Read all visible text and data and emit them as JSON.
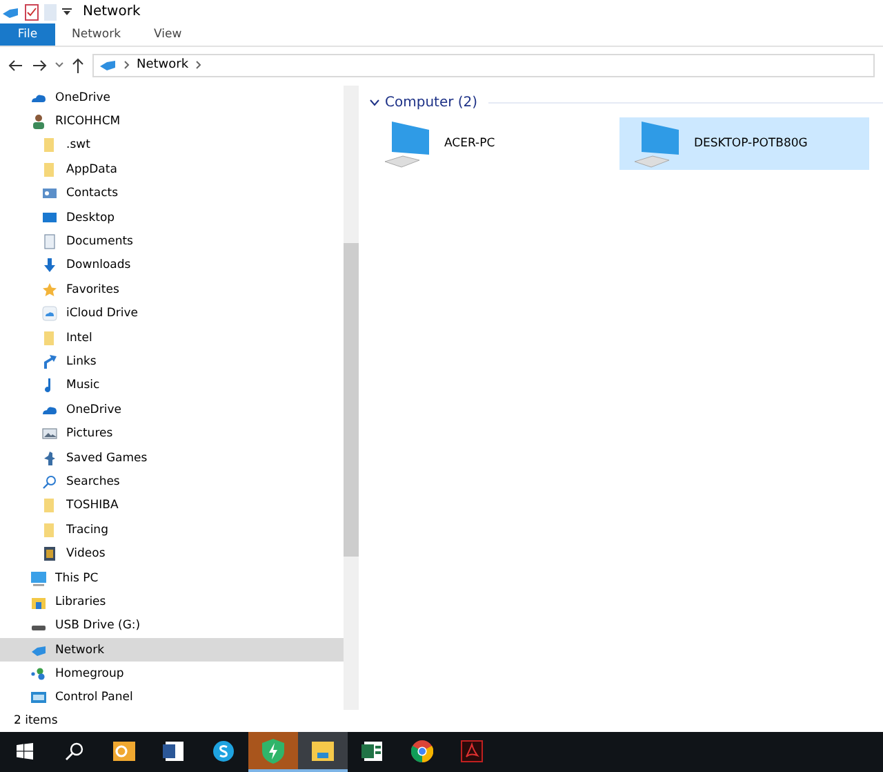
{
  "window": {
    "title": "Network"
  },
  "ribbon_tabs": [
    {
      "label": "File",
      "selected": true
    },
    {
      "label": "Network",
      "selected": false
    },
    {
      "label": "View",
      "selected": false
    }
  ],
  "address": {
    "crumbs": [
      "Network"
    ]
  },
  "nav": [
    {
      "label": "OneDrive",
      "kind": "cloud",
      "selected": false
    },
    {
      "label": "RICOHHCM",
      "kind": "user",
      "selected": false,
      "children": [
        {
          "label": ".swt",
          "kind": "folder",
          "selected": false
        },
        {
          "label": "AppData",
          "kind": "folder",
          "selected": false
        },
        {
          "label": "Contacts",
          "kind": "contacts",
          "selected": false
        },
        {
          "label": "Desktop",
          "kind": "desktop",
          "selected": false
        },
        {
          "label": "Documents",
          "kind": "document",
          "selected": false
        },
        {
          "label": "Downloads",
          "kind": "download",
          "selected": false
        },
        {
          "label": "Favorites",
          "kind": "star",
          "selected": false
        },
        {
          "label": "iCloud Drive",
          "kind": "icloud",
          "selected": false
        },
        {
          "label": "Intel",
          "kind": "folder",
          "selected": false
        },
        {
          "label": "Links",
          "kind": "link",
          "selected": false
        },
        {
          "label": "Music",
          "kind": "music",
          "selected": false
        },
        {
          "label": "OneDrive",
          "kind": "cloud",
          "selected": false
        },
        {
          "label": "Pictures",
          "kind": "pictures",
          "selected": false
        },
        {
          "label": "Saved Games",
          "kind": "games",
          "selected": false
        },
        {
          "label": "Searches",
          "kind": "search",
          "selected": false
        },
        {
          "label": "TOSHIBA",
          "kind": "folder",
          "selected": false
        },
        {
          "label": "Tracing",
          "kind": "folder",
          "selected": false
        },
        {
          "label": "Videos",
          "kind": "video",
          "selected": false
        }
      ]
    },
    {
      "label": "This PC",
      "kind": "pc",
      "selected": false
    },
    {
      "label": "Libraries",
      "kind": "library",
      "selected": false
    },
    {
      "label": "USB Drive (G:)",
      "kind": "usb",
      "selected": false
    },
    {
      "label": "Network",
      "kind": "network",
      "selected": true
    },
    {
      "label": "Homegroup",
      "kind": "homegroup",
      "selected": false
    },
    {
      "label": "Control Panel",
      "kind": "control",
      "selected": false
    }
  ],
  "group": {
    "title": "Computer (2)",
    "expanded": true,
    "items": [
      {
        "label": "ACER-PC",
        "selected": false
      },
      {
        "label": "DESKTOP-POTB80G",
        "selected": true
      }
    ]
  },
  "status_bar": "2 items",
  "taskbar": [
    {
      "kind": "start",
      "active": false
    },
    {
      "kind": "search",
      "active": false
    },
    {
      "kind": "outlook",
      "active": false
    },
    {
      "kind": "word",
      "active": false
    },
    {
      "kind": "skype",
      "active": false
    },
    {
      "kind": "shield",
      "active": true
    },
    {
      "kind": "explorer",
      "active": true
    },
    {
      "kind": "excel",
      "active": false
    },
    {
      "kind": "chrome",
      "active": false
    },
    {
      "kind": "pdf",
      "active": false
    }
  ]
}
